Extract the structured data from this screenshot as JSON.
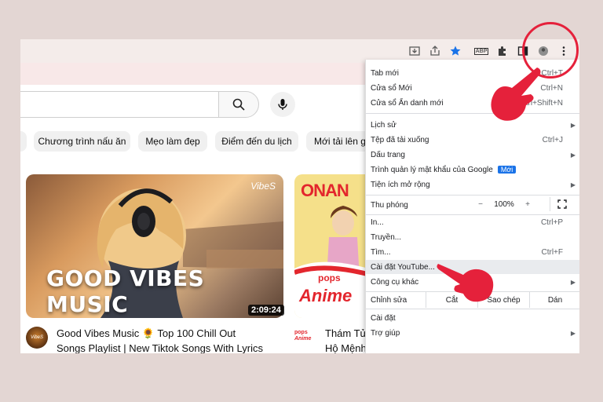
{
  "colors": {
    "background": "#e3d6d3",
    "annotation_red": "#e5213b",
    "menu_badge": "#1a73e8"
  },
  "toolbar": {
    "icons": [
      "download-icon",
      "share-icon",
      "star-icon",
      "adblock-extension-icon",
      "extensions-puzzle-icon",
      "side-panel-icon",
      "profile-icon",
      "more-menu-icon"
    ],
    "extension_badge": "ABP"
  },
  "youtube": {
    "chips": [
      "Chương trình nấu ăn",
      "Mẹo làm đẹp",
      "Điểm đến du lịch",
      "Mới tải lên gầ"
    ],
    "video1": {
      "thumbnail_title": "GOOD VIBES MUSIC",
      "thumbnail_brand": "VibeS",
      "duration": "2:09:24",
      "title_line1": "Good Vibes Music 🌻 Top 100 Chill Out",
      "title_line2": "Songs Playlist | New Tiktok Songs With Lyrics"
    },
    "video2": {
      "thumbnail_brand_top": "ONAN",
      "thumbnail_brand_pops": "pops",
      "thumbnail_brand_anime": "Anime",
      "channel_pops": "pops",
      "channel_anime": "Anime",
      "title_line1": "Thám Tử",
      "title_line2": "Hộ Mệnh"
    }
  },
  "menu": {
    "new_tab": {
      "label": "Tab mới",
      "shortcut": "Ctrl+T"
    },
    "new_window": {
      "label": "Cửa sổ Mới",
      "shortcut": "Ctrl+N"
    },
    "incognito": {
      "label": "Cửa sổ Ẩn danh mới",
      "shortcut": "Ctrl+Shift+N"
    },
    "history": {
      "label": "Lịch sử"
    },
    "downloads": {
      "label": "Tệp đã tải xuống",
      "shortcut": "Ctrl+J"
    },
    "bookmarks": {
      "label": "Dấu trang"
    },
    "password_manager": {
      "label": "Trình quản lý mật khẩu của Google",
      "badge": "Mới"
    },
    "extensions": {
      "label": "Tiện ích mở rộng"
    },
    "zoom": {
      "label": "Thu phóng",
      "minus": "−",
      "value": "100%",
      "plus": "+"
    },
    "print": {
      "label": "In...",
      "shortcut": "Ctrl+P"
    },
    "cast": {
      "label": "Truyền..."
    },
    "find": {
      "label": "Tìm...",
      "shortcut": "Ctrl+F"
    },
    "install_youtube": {
      "label": "Cài đặt YouTube..."
    },
    "more_tools": {
      "label": "Công cụ khác"
    },
    "edit": {
      "label": "Chỉnh sửa",
      "cut": "Cắt",
      "copy": "Sao chép",
      "paste": "Dán"
    },
    "settings": {
      "label": "Cài đặt"
    },
    "help": {
      "label": "Trợ giúp"
    }
  }
}
